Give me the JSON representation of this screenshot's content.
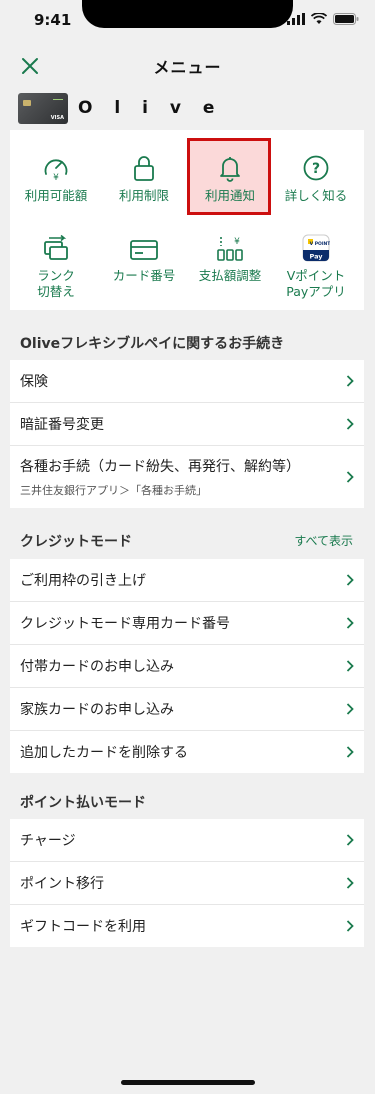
{
  "status": {
    "time": "9:41"
  },
  "header": {
    "title": "メニュー"
  },
  "card": {
    "brand": "O l i v e",
    "network": "VISA"
  },
  "shortcuts": [
    {
      "label": "利用可能額",
      "icon": "gauge-yen-icon"
    },
    {
      "label": "利用制限",
      "icon": "lock-icon"
    },
    {
      "label": "利用通知",
      "icon": "bell-icon",
      "highlighted": true
    },
    {
      "label": "詳しく知る",
      "icon": "question-circle-icon"
    },
    {
      "label": "ランク\n切替え",
      "label_line1": "ランク",
      "label_line2": "切替え",
      "icon": "rank-switch-icon"
    },
    {
      "label": "カード番号",
      "icon": "credit-card-icon"
    },
    {
      "label": "支払額調整",
      "icon": "payment-adjust-icon"
    },
    {
      "label_line1": "Vポイント",
      "label_line2": "Payアプリ",
      "icon": "vpoint-pay-app-icon",
      "app_badge_top": "V POINT",
      "app_badge_bottom": "Pay"
    }
  ],
  "sections": {
    "flexible": {
      "title": "Oliveフレキシブルペイに関するお手続き",
      "items": [
        {
          "label": "保険"
        },
        {
          "label": "暗証番号変更"
        },
        {
          "label": "各種お手続（カード紛失、再発行、解約等）",
          "sub": "三井住友銀行アプリ＞「各種お手続」"
        }
      ]
    },
    "credit": {
      "title": "クレジットモード",
      "show_all": "すべて表示",
      "items": [
        {
          "label": "ご利用枠の引き上げ"
        },
        {
          "label": "クレジットモード専用カード番号"
        },
        {
          "label": "付帯カードのお申し込み"
        },
        {
          "label": "家族カードのお申し込み"
        },
        {
          "label": "追加したカードを削除する"
        }
      ]
    },
    "points": {
      "title": "ポイント払いモード",
      "items": [
        {
          "label": "チャージ"
        },
        {
          "label": "ポイント移行"
        },
        {
          "label": "ギフトコードを利用"
        }
      ]
    }
  },
  "colors": {
    "accent": "#1a7a4e",
    "highlight_border": "#cc0f0f",
    "highlight_fill": "#fbd9d9",
    "background": "#f0f0f0"
  }
}
